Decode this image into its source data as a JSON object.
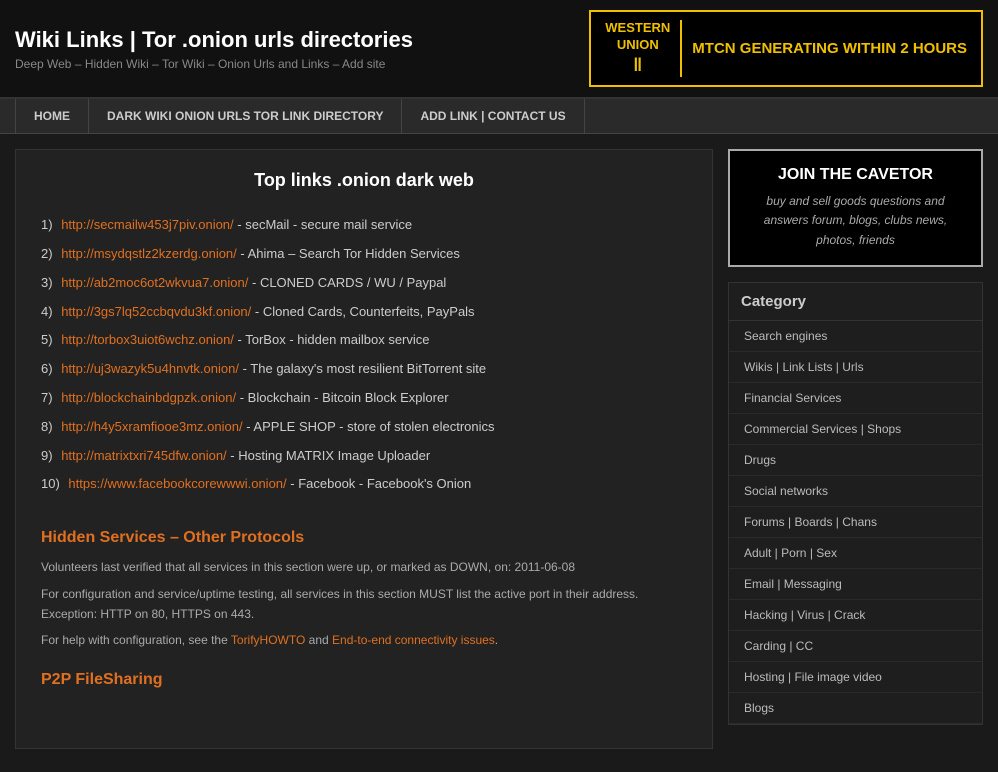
{
  "header": {
    "title": "Wiki Links | Tor .onion urls directories",
    "subtitle": "Deep Web – Hidden Wiki – Tor Wiki – Onion Urls and Links – Add site",
    "wu_logo_line1": "WESTERN",
    "wu_logo_line2": "UNION",
    "wu_tagline": "MTCN GENERATING WITHIN 2 HOURS"
  },
  "nav": {
    "items": [
      {
        "label": "HOME"
      },
      {
        "label": "DARK WIKI ONION URLS TOR LINK DIRECTORY"
      },
      {
        "label": "ADD LINK | CONTACT US"
      }
    ]
  },
  "content": {
    "title": "Top links .onion dark web",
    "links": [
      {
        "num": "1)",
        "url": "http://secmailw453j7piv.onion/",
        "desc": "- secMail - secure mail service"
      },
      {
        "num": "2)",
        "url": "http://msydqstlz2kzerdg.onion/",
        "desc": "- Ahima – Search Tor Hidden Services"
      },
      {
        "num": "3)",
        "url": "http://ab2moc6ot2wkvua7.onion/",
        "desc": "- CLONED CARDS / WU / Paypal"
      },
      {
        "num": "4)",
        "url": "http://3gs7lq52ccbqvdu3kf.onion/",
        "desc": "- Cloned Cards, Counterfeits, PayPals"
      },
      {
        "num": "5)",
        "url": "http://torbox3uiot6wchz.onion/",
        "desc": "- TorBox - hidden mailbox service"
      },
      {
        "num": "6)",
        "url": "http://uj3wazyk5u4hnvtk.onion/",
        "desc": "- The galaxy's most resilient BitTorrent site"
      },
      {
        "num": "7)",
        "url": "http://blockchainbdgpzk.onion/",
        "desc": "- Blockchain - Bitcoin Block Explorer"
      },
      {
        "num": "8)",
        "url": "http://h4y5xramfiooe3mz.onion/",
        "desc": "- APPLE SHOP - store of stolen electronics"
      },
      {
        "num": "9)",
        "url": "http://matrixtxri745dfw.onion/",
        "desc": "- Hosting MATRIX Image Uploader"
      },
      {
        "num": "10)",
        "url": "https://www.facebookcorewwwi.onion/",
        "desc": "- Facebook - Facebook's Onion"
      }
    ],
    "hidden_services_title": "Hidden Services – Other Protocols",
    "hidden_services_p1": "Volunteers last verified that all services in this section were up, or marked as DOWN, on: 2011-06-08",
    "hidden_services_p2": "For configuration and service/uptime testing, all services in this section MUST list the active port in their address. Exception: HTTP on 80, HTTPS on 443.",
    "hidden_services_p3_pre": "For help with configuration, see the ",
    "hidden_services_link1": "TorifyHOWTO",
    "hidden_services_p3_mid": " and ",
    "hidden_services_link2": "End-to-end connectivity issues",
    "hidden_services_p3_post": ".",
    "p2p_title": "P2P FileSharing"
  },
  "sidebar": {
    "cavetor_title": "JOIN THE CAVETOR",
    "cavetor_desc": "buy and sell goods questions and answers forum, blogs, clubs news, photos, friends",
    "category_title": "Category",
    "categories": [
      {
        "label": "Search engines"
      },
      {
        "label": "Wikis | Link Lists | Urls"
      },
      {
        "label": "Financial Services"
      },
      {
        "label": "Commercial Services | Shops"
      },
      {
        "label": "Drugs"
      },
      {
        "label": "Social networks"
      },
      {
        "label": "Forums | Boards | Chans"
      },
      {
        "label": "Adult | Porn | Sex"
      },
      {
        "label": "Email | Messaging"
      },
      {
        "label": "Hacking | Virus | Crack"
      },
      {
        "label": "Carding | CC"
      },
      {
        "label": "Hosting | File image video"
      },
      {
        "label": "Blogs"
      }
    ]
  }
}
